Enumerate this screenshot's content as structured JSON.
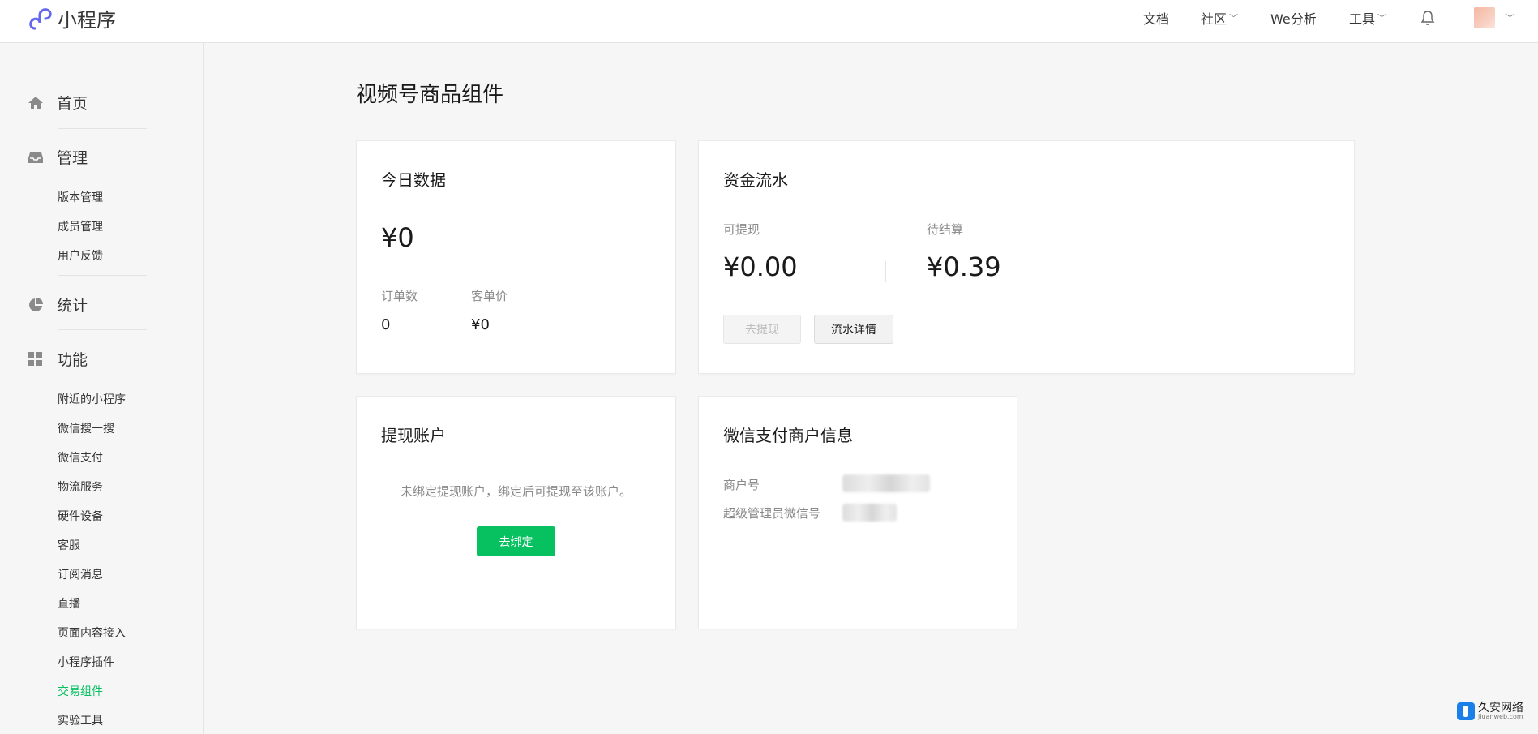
{
  "header": {
    "app_name": "小程序",
    "nav": {
      "docs": "文档",
      "community": "社区",
      "analytics": "We分析",
      "tools": "工具"
    }
  },
  "sidebar": {
    "home": "首页",
    "manage": "管理",
    "manage_items": [
      "版本管理",
      "成员管理",
      "用户反馈"
    ],
    "stats": "统计",
    "features": "功能",
    "feature_items": [
      "附近的小程序",
      "微信搜一搜",
      "微信支付",
      "物流服务",
      "硬件设备",
      "客服",
      "订阅消息",
      "直播",
      "页面内容接入",
      "小程序插件",
      "交易组件",
      "实验工具"
    ],
    "active_item": "交易组件"
  },
  "main": {
    "page_title": "视频号商品组件",
    "today": {
      "title": "今日数据",
      "amount": "¥0",
      "orders_label": "订单数",
      "orders_value": "0",
      "avg_label": "客单价",
      "avg_value": "¥0"
    },
    "funds": {
      "title": "资金流水",
      "withdrawable_label": "可提现",
      "withdrawable_value": "¥0.00",
      "pending_label": "待结算",
      "pending_value": "¥0.39",
      "withdraw_button": "去提现",
      "details_button": "流水详情"
    },
    "account": {
      "title": "提现账户",
      "message": "未绑定提现账户，绑定后可提现至该账户。",
      "bind_button": "去绑定"
    },
    "merchant": {
      "title": "微信支付商户信息",
      "merchant_id_label": "商户号",
      "admin_label": "超级管理员微信号"
    }
  },
  "watermark": {
    "cn": "久安网络",
    "en": "jiuanweb.com"
  },
  "colors": {
    "accent": "#07c160",
    "logo": "#6467f0"
  }
}
